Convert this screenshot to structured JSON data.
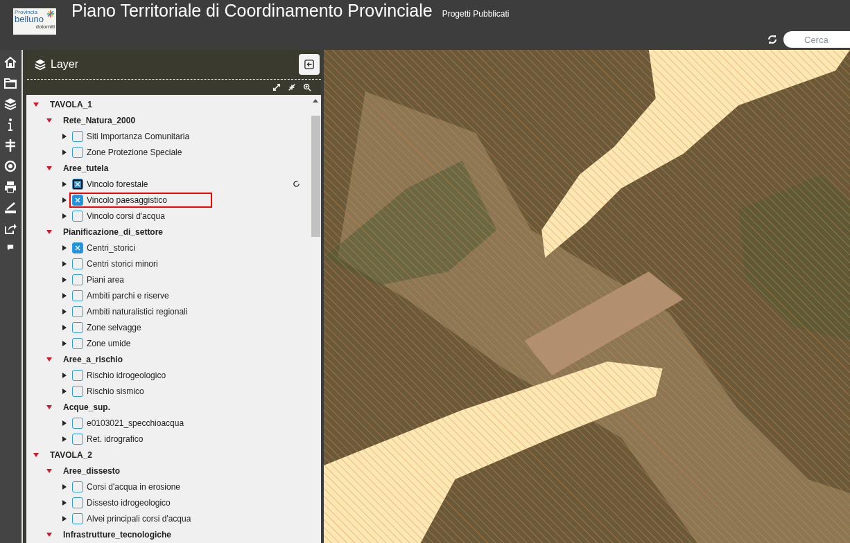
{
  "header": {
    "logo": {
      "top": "Provincia",
      "main": "belluno",
      "sub": "dolomiti"
    },
    "title": "Piano Territoriale di Coordinamento Provinciale",
    "subtitle": "Progetti Pubblicati",
    "search": {
      "placeholder": "Cerca"
    }
  },
  "panel": {
    "title": "Layer"
  },
  "tree": [
    {
      "label": "TAVOLA_1",
      "expanded": true,
      "children": [
        {
          "label": "Rete_Natura_2000",
          "expanded": true,
          "children": [
            {
              "label": "Siti Importanza Comunitaria",
              "checked": false,
              "highlighted": false,
              "loading": false
            },
            {
              "label": "Zone Protezione Speciale",
              "checked": false,
              "highlighted": false,
              "loading": false
            }
          ]
        },
        {
          "label": "Aree_tutela",
          "expanded": true,
          "children": [
            {
              "label": "Vincolo forestale",
              "checked": true,
              "highlighted": false,
              "loading": true
            },
            {
              "label": "Vincolo paesaggistico",
              "checked": true,
              "highlighted": true,
              "loading": false
            },
            {
              "label": "Vincolo corsi d'acqua",
              "checked": false,
              "highlighted": false,
              "loading": false
            }
          ]
        },
        {
          "label": "Pianificazione_di_settore",
          "expanded": true,
          "children": [
            {
              "label": "Centri_storici",
              "checked": true,
              "highlighted": false,
              "loading": false
            },
            {
              "label": "Centri storici minori",
              "checked": false,
              "highlighted": false,
              "loading": false
            },
            {
              "label": "Piani area",
              "checked": false,
              "highlighted": false,
              "loading": false
            },
            {
              "label": "Ambiti parchi e riserve",
              "checked": false,
              "highlighted": false,
              "loading": false
            },
            {
              "label": "Ambiti naturalistici regionali",
              "checked": false,
              "highlighted": false,
              "loading": false
            },
            {
              "label": "Zone selvagge",
              "checked": false,
              "highlighted": false,
              "loading": false
            },
            {
              "label": "Zone umide",
              "checked": false,
              "highlighted": false,
              "loading": false
            }
          ]
        },
        {
          "label": "Aree_a_rischio",
          "expanded": true,
          "children": [
            {
              "label": "Rischio idrogeologico",
              "checked": false,
              "highlighted": false,
              "loading": false
            },
            {
              "label": "Rischio sismico",
              "checked": false,
              "highlighted": false,
              "loading": false
            }
          ]
        },
        {
          "label": "Acque_sup.",
          "expanded": true,
          "children": [
            {
              "label": "e0103021_specchioacqua",
              "checked": false,
              "highlighted": false,
              "loading": false
            },
            {
              "label": "Ret. idrografico",
              "checked": false,
              "highlighted": false,
              "loading": false
            }
          ]
        }
      ]
    },
    {
      "label": "TAVOLA_2",
      "expanded": true,
      "children": [
        {
          "label": "Aree_dissesto",
          "expanded": true,
          "children": [
            {
              "label": "Corsi d'acqua in erosione",
              "checked": false,
              "highlighted": false,
              "loading": false
            },
            {
              "label": "Dissesto idrogeologico",
              "checked": false,
              "highlighted": false,
              "loading": false
            },
            {
              "label": "Alvei principali corsi d'acqua",
              "checked": false,
              "highlighted": false,
              "loading": false
            }
          ]
        },
        {
          "label": "Infrastrutture_tecnologiche",
          "expanded": true
        }
      ]
    }
  ]
}
